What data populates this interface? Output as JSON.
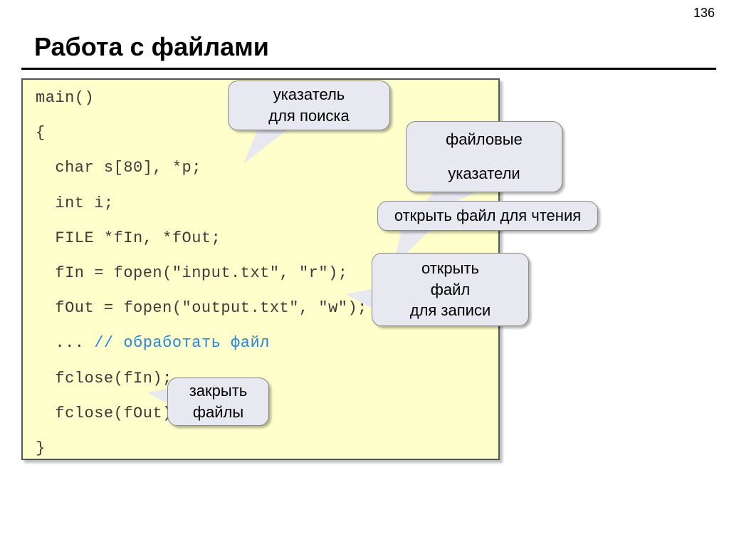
{
  "page_number": "136",
  "title": "Работа с файлами",
  "code": {
    "l1": "main()",
    "l2": "{",
    "l3": "  char s[80], *p;",
    "l4": "  int i;",
    "l5": "  FILE *fIn, *fOut;",
    "l6": "  fIn = fopen(\"input.txt\", \"r\");",
    "l7": "  fOut = fopen(\"output.txt\", \"w\");",
    "l8a": "  ... ",
    "l8b": "// обработать файл",
    "l9": "  fclose(fIn);",
    "l10": "  fclose(fOut);",
    "l11": "}"
  },
  "callouts": {
    "pointer_search_l1": "указатель",
    "pointer_search_l2": "для поиска",
    "file_pointers_l1": "файловые",
    "file_pointers_l2": "указатели",
    "open_read": "открыть файл для чтения",
    "open_write_l1": "открыть",
    "open_write_l2": "файл",
    "open_write_l3": "для записи",
    "close_l1": "закрыть",
    "close_l2": "файлы"
  }
}
